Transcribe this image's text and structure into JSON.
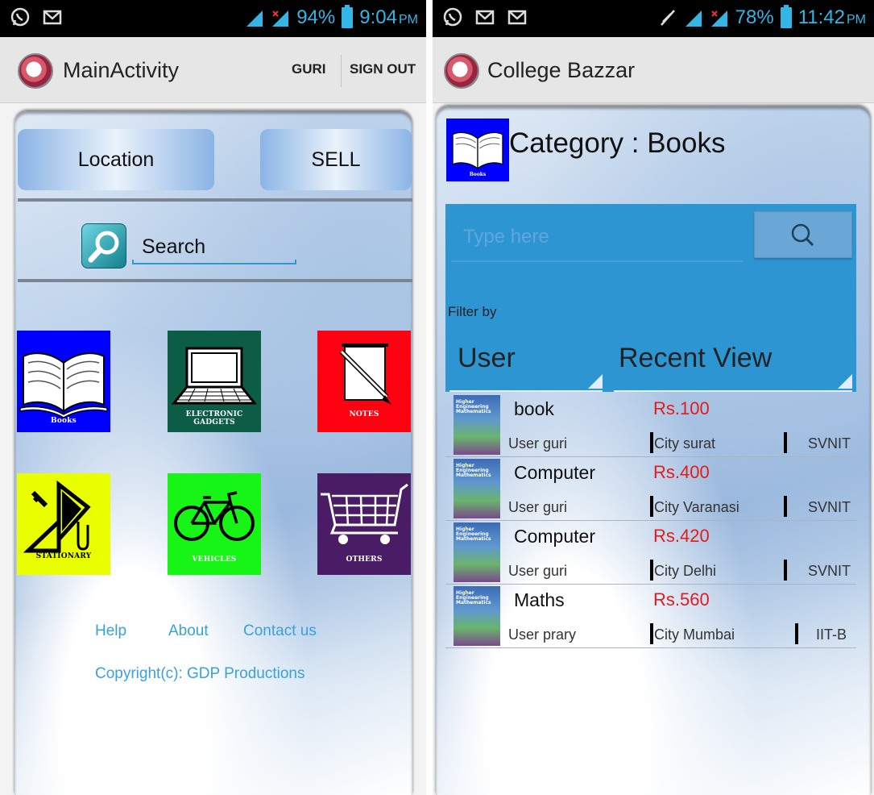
{
  "left_screen": {
    "status": {
      "battery": "94%",
      "time": "9:04",
      "ampm": "PM"
    },
    "actionbar": {
      "title": "MainActivity",
      "user_button": "GURI",
      "signout_button": "SIGN OUT"
    },
    "buttons": {
      "location": "Location",
      "sell": "SELL"
    },
    "search": {
      "label": "Search"
    },
    "categories": [
      {
        "caption": "Books",
        "icon": "book-icon",
        "color": "#0000ff"
      },
      {
        "caption": "ELECTRONIC GADGETS",
        "icon": "laptop-icon",
        "color": "#0d5c46"
      },
      {
        "caption": "NOTES",
        "icon": "notes-icon",
        "color": "#ff0010"
      },
      {
        "caption": "STATIONARY",
        "icon": "stationary-icon",
        "color": "#e9ff00"
      },
      {
        "caption": "VEHICLES",
        "icon": "bicycle-icon",
        "color": "#16f516"
      },
      {
        "caption": "OTHERS",
        "icon": "cart-icon",
        "color": "#4a1c66"
      }
    ],
    "footer": {
      "help": "Help",
      "about": "About",
      "contact": "Contact us",
      "copyright": "Copyright(c):  GDP Productions"
    }
  },
  "right_screen": {
    "status": {
      "battery": "78%",
      "time": "11:42",
      "ampm": "PM"
    },
    "actionbar": {
      "title": "College Bazzar"
    },
    "category_title": "Category : Books",
    "category_icon_caption": "Books",
    "search": {
      "placeholder": "Type here"
    },
    "filter_label": "Filter by",
    "filters": {
      "first": "User",
      "second": "Recent View"
    },
    "listings": [
      {
        "name": "book",
        "price": "Rs.100",
        "user": "User guri",
        "city": "City surat",
        "college": "SVNIT"
      },
      {
        "name": "Computer",
        "price": "Rs.400",
        "user": "User guri",
        "city": "City Varanasi",
        "college": "SVNIT"
      },
      {
        "name": "Computer",
        "price": "Rs.420",
        "user": "User guri",
        "city": "City Delhi",
        "college": "SVNIT"
      },
      {
        "name": "Maths",
        "price": "Rs.560",
        "user": "User prary",
        "city": "City Mumbai",
        "college": "IIT-B"
      }
    ],
    "thumbnail_text": "Higher Engineering Mathematics"
  }
}
